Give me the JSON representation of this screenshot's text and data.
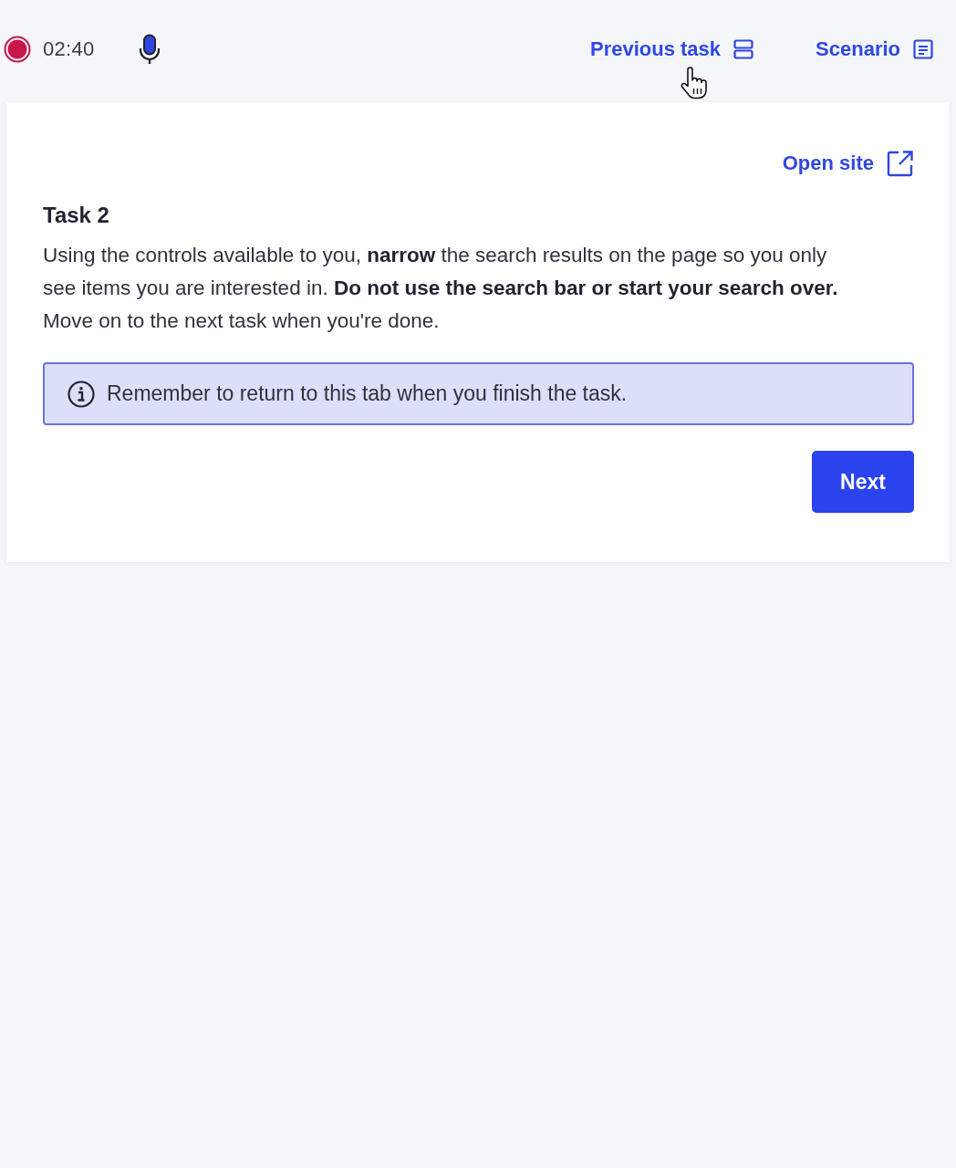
{
  "top_bar": {
    "recorder": {
      "recording": true,
      "time": "02:40"
    },
    "microphone": {
      "active": true
    },
    "links": [
      {
        "label": "Previous task",
        "kind": "rows"
      },
      {
        "label": "Scenario",
        "kind": "notes"
      }
    ]
  },
  "task_card": {
    "open_site": "Open site",
    "title": "Task 2",
    "instructions": "Using the controls available to you, **narrow** the search results on the page so you only see items you are interested in. **Do not use the search bar or start your search over.** Move on to the next task when you're done.",
    "notice": "Remember to return to this tab when you finish the task.",
    "next_button": "Next"
  }
}
